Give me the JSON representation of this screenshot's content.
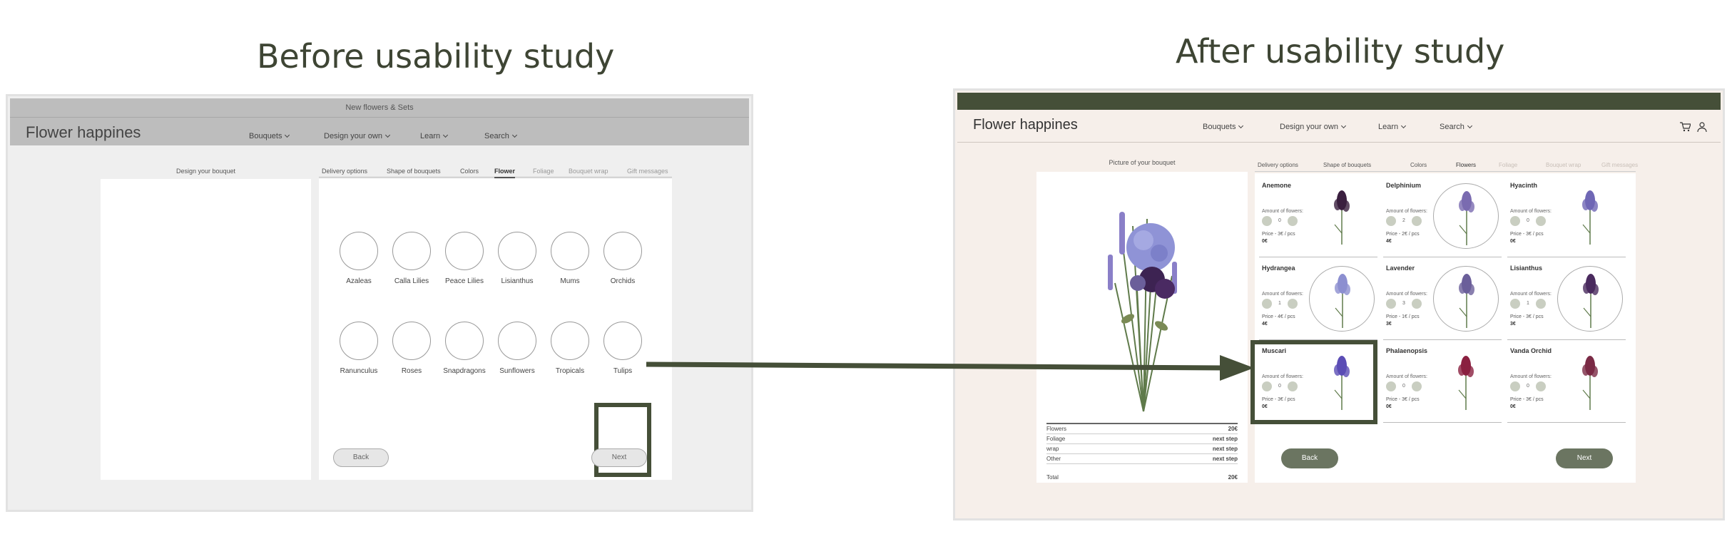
{
  "captions": {
    "before": "Before usability study",
    "after": "After usability study"
  },
  "before": {
    "banner": "New flowers & Sets",
    "logo": "Flower happines",
    "nav": [
      "Bouquets",
      "Design your own",
      "Learn",
      "Search"
    ],
    "preview_title": "Design your bouquet",
    "tabs": [
      {
        "label": "Delivery options",
        "state": "normal"
      },
      {
        "label": "Shape of bouquets",
        "state": "normal"
      },
      {
        "label": "Colors",
        "state": "normal"
      },
      {
        "label": "Flower",
        "state": "active"
      },
      {
        "label": "Foliage",
        "state": "dim"
      },
      {
        "label": "Bouquet wrap",
        "state": "dim"
      },
      {
        "label": "Gift messages",
        "state": "dim"
      }
    ],
    "flowers": [
      "Azaleas",
      "Calla Lilies",
      "Peace Lilies",
      "Lisianthus",
      "Mums",
      "Orchids",
      "Ranunculus",
      "Roses",
      "Snapdragons",
      "Sunflowers",
      "Tropicals",
      "Tulips"
    ],
    "back": "Back",
    "next": "Next"
  },
  "after": {
    "logo": "Flower happines",
    "nav": [
      "Bouquets",
      "Design your own",
      "Learn",
      "Search"
    ],
    "icons": [
      "cart-icon",
      "user-icon"
    ],
    "preview_title": "Picture of your bouquet",
    "summary": [
      {
        "label": "Flowers",
        "value": "20€"
      },
      {
        "label": "Foliage",
        "value": "next step"
      },
      {
        "label": "wrap",
        "value": "next step"
      },
      {
        "label": "Other",
        "value": "next step"
      }
    ],
    "total": {
      "label": "Total",
      "value": "20€"
    },
    "tabs": [
      {
        "label": "Delivery options",
        "state": "normal"
      },
      {
        "label": "Shape of bouquets",
        "state": "normal"
      },
      {
        "label": "Colors",
        "state": "normal"
      },
      {
        "label": "Flowers",
        "state": "active"
      },
      {
        "label": "Foliage",
        "state": "dim"
      },
      {
        "label": "Bouquet wrap",
        "state": "dim"
      },
      {
        "label": "Gift messages",
        "state": "dim"
      }
    ],
    "amount_label": "Amount of flowers:",
    "cards": [
      {
        "name": "Anemone",
        "qty": "0",
        "price": "Price - 3€ / pcs",
        "subtotal": "0€",
        "circled": false,
        "color": "#3a1f3f"
      },
      {
        "name": "Delphinium",
        "qty": "2",
        "price": "Price - 2€ / pcs",
        "subtotal": "4€",
        "circled": true,
        "color": "#7a6bb0"
      },
      {
        "name": "Hyacinth",
        "qty": "0",
        "price": "Price - 3€ / pcs",
        "subtotal": "0€",
        "circled": false,
        "color": "#6f67b5"
      },
      {
        "name": "Hydrangea",
        "qty": "1",
        "price": "Price - 4€ / pcs",
        "subtotal": "4€",
        "circled": true,
        "color": "#8c8fd0"
      },
      {
        "name": "Lavender",
        "qty": "3",
        "price": "Price - 1€ / pcs",
        "subtotal": "3€",
        "circled": true,
        "color": "#6b5f9a"
      },
      {
        "name": "Lisianthus",
        "qty": "1",
        "price": "Price - 3€ / pcs",
        "subtotal": "3€",
        "circled": true,
        "color": "#4a2a5e"
      },
      {
        "name": "Muscari",
        "qty": "0",
        "price": "Price - 3€ / pcs",
        "subtotal": "0€",
        "circled": false,
        "color": "#5b4db5"
      },
      {
        "name": "Phalaenopsis",
        "qty": "0",
        "price": "Price - 3€ / pcs",
        "subtotal": "0€",
        "circled": false,
        "color": "#8a2040"
      },
      {
        "name": "Vanda Orchid",
        "qty": "0",
        "price": "Price - 3€ / pcs",
        "subtotal": "0€",
        "circled": false,
        "color": "#7a2a45"
      }
    ],
    "back": "Back",
    "next": "Next",
    "brand_color": "#454f38"
  }
}
